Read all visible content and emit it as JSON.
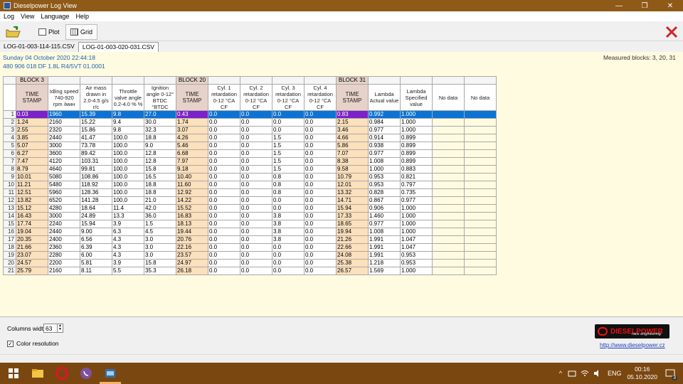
{
  "window": {
    "title": "Dieselpower Log View",
    "controls": [
      "—",
      "❐",
      "✕"
    ]
  },
  "menu": [
    "Log",
    "View",
    "Language",
    "Help"
  ],
  "toolbar": {
    "plot_label": "Plot",
    "grid_label": "Grid"
  },
  "tabs": [
    "LOG-01-003-114-115.CSV",
    "LOG-01-003-020-031.CSV"
  ],
  "info": {
    "date_line": "Sunday 04 October 2020 22:44:18",
    "ecu_line": "480 906 018 DF  1.8L R4/5VT     01.0001",
    "measured_blocks": "Measured blocks: 3, 20, 31"
  },
  "blocks": [
    {
      "label": "BLOCK 3",
      "span": 5
    },
    {
      "label": "BLOCK 20",
      "span": 5
    },
    {
      "label": "BLOCK 31",
      "span": 5
    }
  ],
  "headers": [
    "TIME STAMP",
    "Idling speed 740-920 rpm /мин",
    "Air mass drawn in 2.0-4.5 g/s r/c",
    "Throttle valve angle 0.2-4.0 % %",
    "Ignition angle 0-12° BTDC °BTDC",
    "TIME STAMP",
    "Cyl. 1 retardation 0-12 °CA CF",
    "Cyl. 2 retardation 0-12 °CA CF",
    "Cyl. 3 retardation 0-12 °CA CF",
    "Cyl. 4 retardation 0-12 °CA CF",
    "TIME STAMP",
    "Lambda Actual value",
    "Lambda Specified value",
    "No data",
    "No data"
  ],
  "rows": [
    [
      "0.03",
      "1960",
      "15.39",
      "9.8",
      "27.0",
      "0.43",
      "0.0",
      "0.0",
      "0.0",
      "0.0",
      "0.83",
      "0.992",
      "1.000",
      "",
      ""
    ],
    [
      "1.24",
      "2160",
      "15.22",
      "9.4",
      "30.0",
      "1.74",
      "0.0",
      "0.0",
      "0.0",
      "0.0",
      "2.15",
      "0.984",
      "1.000",
      "",
      ""
    ],
    [
      "2.55",
      "2320",
      "15.86",
      "9.8",
      "32.3",
      "3.07",
      "0.0",
      "0.0",
      "0.0",
      "0.0",
      "3.46",
      "0.977",
      "1.000",
      "",
      ""
    ],
    [
      "3.85",
      "2440",
      "41.47",
      "100.0",
      "18.8",
      "4.26",
      "0.0",
      "0.0",
      "1.5",
      "0.0",
      "4.66",
      "0.914",
      "0.899",
      "",
      ""
    ],
    [
      "5.07",
      "3000",
      "73.78",
      "100.0",
      "9.0",
      "5.46",
      "0.0",
      "0.0",
      "1.5",
      "0.0",
      "5.86",
      "0.938",
      "0.899",
      "",
      ""
    ],
    [
      "6.27",
      "3600",
      "89.42",
      "100.0",
      "12.8",
      "6.68",
      "0.0",
      "0.0",
      "1.5",
      "0.0",
      "7.07",
      "0.977",
      "0.899",
      "",
      ""
    ],
    [
      "7.47",
      "4120",
      "103.31",
      "100.0",
      "12.8",
      "7.97",
      "0.0",
      "0.0",
      "1.5",
      "0.0",
      "8.38",
      "1.008",
      "0.899",
      "",
      ""
    ],
    [
      "8.79",
      "4640",
      "99.81",
      "100.0",
      "15.8",
      "9.18",
      "0.0",
      "0.0",
      "1.5",
      "0.0",
      "9.58",
      "1.000",
      "0.883",
      "",
      ""
    ],
    [
      "10.01",
      "5080",
      "108.86",
      "100.0",
      "16.5",
      "10.40",
      "0.0",
      "0.0",
      "0.8",
      "0.0",
      "10.79",
      "0.953",
      "0.821",
      "",
      ""
    ],
    [
      "11.21",
      "5480",
      "118.92",
      "100.0",
      "18.8",
      "11.60",
      "0.0",
      "0.0",
      "0.8",
      "0.0",
      "12.01",
      "0.953",
      "0.797",
      "",
      ""
    ],
    [
      "12.51",
      "5960",
      "128.36",
      "100.0",
      "18.8",
      "12.92",
      "0.0",
      "0.0",
      "0.8",
      "0.0",
      "13.32",
      "0.828",
      "0.735",
      "",
      ""
    ],
    [
      "13.82",
      "6520",
      "141.28",
      "100.0",
      "21.0",
      "14.22",
      "0.0",
      "0.0",
      "0.0",
      "0.0",
      "14.71",
      "0.867",
      "0.977",
      "",
      ""
    ],
    [
      "15.12",
      "4280",
      "18.64",
      "11.4",
      "42.0",
      "15.52",
      "0.0",
      "0.0",
      "0.0",
      "0.0",
      "15.94",
      "0.906",
      "1.000",
      "",
      ""
    ],
    [
      "16.43",
      "3000",
      "24.89",
      "13.3",
      "36.0",
      "16.83",
      "0.0",
      "0.0",
      "3.8",
      "0.0",
      "17.33",
      "1.460",
      "1.000",
      "",
      ""
    ],
    [
      "17.74",
      "2240",
      "15.94",
      "3.9",
      "1.5",
      "18.13",
      "0.0",
      "0.0",
      "3.8",
      "0.0",
      "18.65",
      "0.977",
      "1.000",
      "",
      ""
    ],
    [
      "19.04",
      "2440",
      "9.00",
      "6.3",
      "4.5",
      "19.44",
      "0.0",
      "0.0",
      "3.8",
      "0.0",
      "19.94",
      "1.008",
      "1.000",
      "",
      ""
    ],
    [
      "20.35",
      "2400",
      "6.56",
      "4.3",
      "3.0",
      "20.76",
      "0.0",
      "0.0",
      "3.8",
      "0.0",
      "21.26",
      "1.991",
      "1.047",
      "",
      ""
    ],
    [
      "21.66",
      "2360",
      "6.39",
      "4.3",
      "3.0",
      "22.16",
      "0.0",
      "0.0",
      "0.0",
      "0.0",
      "22.66",
      "1.991",
      "1.047",
      "",
      ""
    ],
    [
      "23.07",
      "2280",
      "6.00",
      "4.3",
      "3.0",
      "23.57",
      "0.0",
      "0.0",
      "0.0",
      "0.0",
      "24.08",
      "1.991",
      "0.953",
      "",
      ""
    ],
    [
      "24.57",
      "2200",
      "5.81",
      "3.9",
      "15.8",
      "24.97",
      "0.0",
      "0.0",
      "0.0",
      "0.0",
      "25.38",
      "1.218",
      "0.953",
      "",
      ""
    ],
    [
      "25.79",
      "2160",
      "8.11",
      "5.5",
      "35.3",
      "26.18",
      "0.0",
      "0.0",
      "0.0",
      "0.0",
      "26.57",
      "1.569",
      "1.000",
      "",
      ""
    ]
  ],
  "bottom": {
    "columns_width_label": "Columns width:",
    "columns_width_value": "63",
    "color_resolution_label": "Color resolution",
    "logo_text": "DIESELPOWER",
    "logo_sub": "race engineering",
    "site_link": "http://www.dieselpower.cz"
  },
  "taskbar": {
    "tray_text": "^",
    "lang": "ENG",
    "time": "00:16",
    "date": "05.10.2020",
    "notification_count": "3"
  }
}
